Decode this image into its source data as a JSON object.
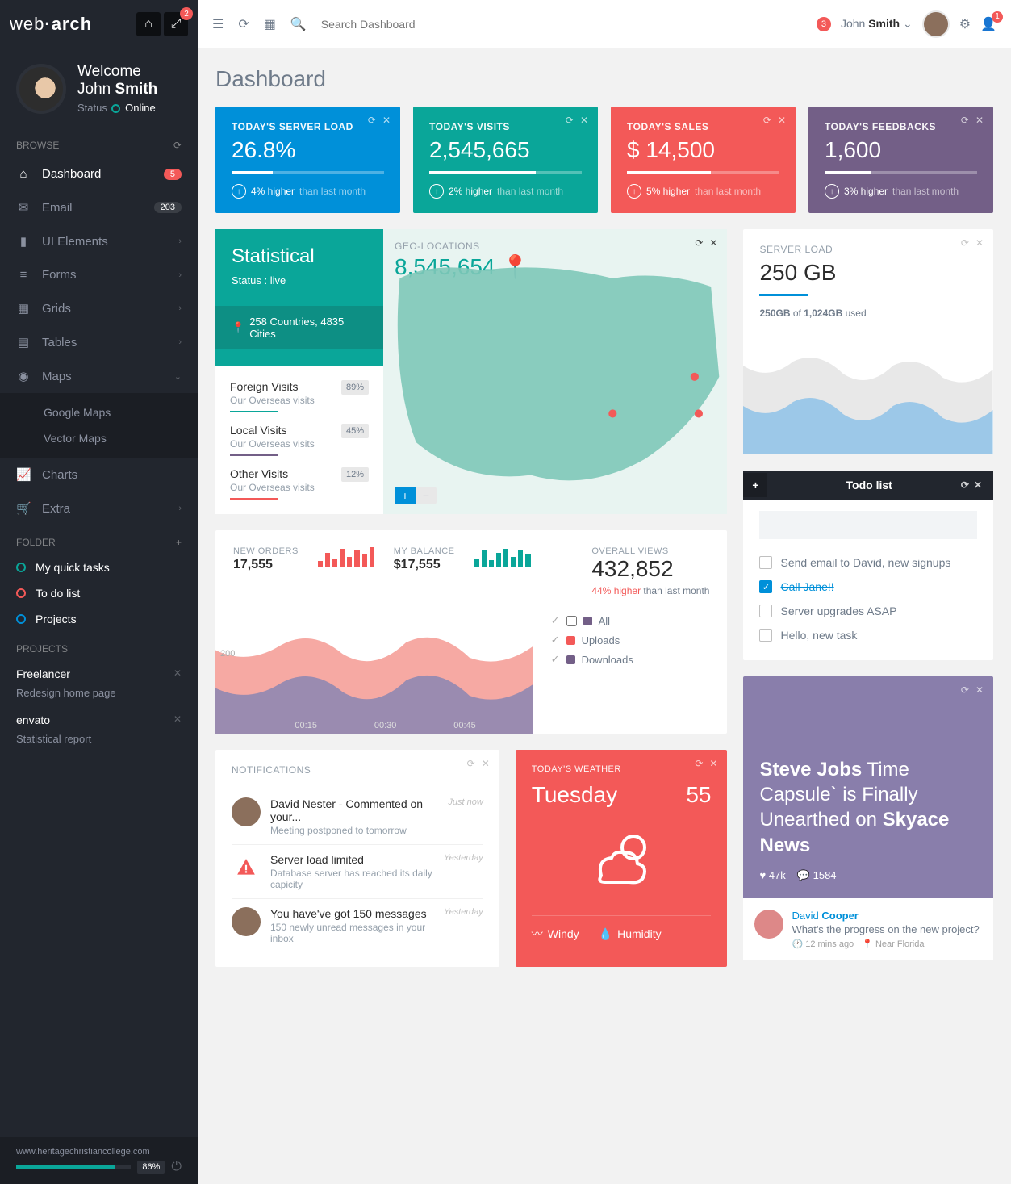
{
  "logo": {
    "part1": "web",
    "part2": "arch",
    "badge": "2"
  },
  "profile": {
    "welcome": "Welcome",
    "first": "John",
    "last": "Smith",
    "statusLabel": "Status",
    "statusVal": "Online"
  },
  "sections": {
    "browse": "BROWSE",
    "folder": "FOLDER",
    "projects": "PROJECTS"
  },
  "nav": {
    "dashboard": {
      "label": "Dashboard",
      "badge": "5"
    },
    "email": {
      "label": "Email",
      "badge": "203"
    },
    "ui": {
      "label": "UI Elements"
    },
    "forms": {
      "label": "Forms"
    },
    "grids": {
      "label": "Grids"
    },
    "tables": {
      "label": "Tables"
    },
    "maps": {
      "label": "Maps",
      "sub": {
        "google": "Google Maps",
        "vector": "Vector Maps"
      }
    },
    "charts": {
      "label": "Charts"
    },
    "extra": {
      "label": "Extra"
    }
  },
  "folders": {
    "quick": "My quick tasks",
    "todo": "To do list",
    "projects": "Projects"
  },
  "projectList": {
    "p1": {
      "name": "Freelancer",
      "sub": "Redesign home page"
    },
    "p2": {
      "name": "envato",
      "sub": "Statistical report"
    }
  },
  "footer": {
    "url": "www.heritagechristiancollege.com",
    "pct": "86%"
  },
  "topbar": {
    "searchPlaceholder": "Search Dashboard",
    "userBadge": "3",
    "userFirst": "John",
    "userLast": "Smith",
    "rightBadge": "1"
  },
  "pageTitle": "Dashboard",
  "stats": {
    "s1": {
      "title": "TODAY'S SERVER LOAD",
      "val": "26.8%",
      "barPct": 27,
      "diff": "4% higher",
      "sub": "than last month"
    },
    "s2": {
      "title": "TODAY'S VISITS",
      "val": "2,545,665",
      "barPct": 70,
      "diff": "2% higher",
      "sub": "than last month"
    },
    "s3": {
      "title": "TODAY'S SALES",
      "val": "$ 14,500",
      "barPct": 55,
      "diff": "5% higher",
      "sub": "than last month"
    },
    "s4": {
      "title": "TODAY'S FEEDBACKS",
      "val": "1,600",
      "barPct": 30,
      "diff": "3% higher",
      "sub": "than last month"
    }
  },
  "statistical": {
    "title": "Statistical",
    "status": "Status : live",
    "countries": "258 Countries, 4835 Cities"
  },
  "geo": {
    "title": "GEO-LOCATIONS",
    "val": "8,545,654"
  },
  "visits": {
    "v1": {
      "name": "Foreign Visits",
      "sub": "Our Overseas visits",
      "pct": "89%"
    },
    "v2": {
      "name": "Local Visits",
      "sub": "Our Overseas visits",
      "pct": "45%"
    },
    "v3": {
      "name": "Other Visits",
      "sub": "Our Overseas visits",
      "pct": "12%"
    }
  },
  "server": {
    "title": "SERVER LOAD",
    "val": "250 GB",
    "used": "250GB",
    "of": "of",
    "total": "1,024GB",
    "usedLabel": "used"
  },
  "orders": {
    "newLabel": "NEW ORDERS",
    "newVal": "17,555",
    "balLabel": "MY BALANCE",
    "balVal": "$17,555",
    "ovLabel": "OVERALL VIEWS",
    "ovVal": "432,852",
    "ovDiff": "44% higher",
    "ovSub": "than last month",
    "leg": {
      "all": "All",
      "up": "Uploads",
      "down": "Downloads"
    },
    "ticks": {
      "t1": "00:15",
      "t2": "00:30",
      "t3": "00:45"
    },
    "yval": "200"
  },
  "notif": {
    "title": "NOTIFICATIONS",
    "n1": {
      "title": "David Nester - Commented on your...",
      "sub": "Meeting postponed to tomorrow",
      "time": "Just now"
    },
    "n2": {
      "title": "Server load limited",
      "sub": "Database server has reached its daily capicity",
      "time": "Yesterday"
    },
    "n3": {
      "title": "You have've got 150 messages",
      "sub": "150 newly unread messages in your inbox",
      "time": "Yesterday"
    }
  },
  "weather": {
    "title": "TODAY'S WEATHER",
    "day": "Tuesday",
    "temp": "55",
    "windy": "Windy",
    "humid": "Humidity"
  },
  "todo": {
    "header": "Todo list",
    "t1": "Send email to David, new signups",
    "t2": "Call Jane!!",
    "t3": "Server upgrades ASAP",
    "t4": "Hello, new task"
  },
  "news": {
    "p1": "Steve Jobs",
    "p2": "Time Capsule` is Finally Unearthed on",
    "p3": "Skyace News",
    "likes": "47k",
    "comments": "1584",
    "commenter": {
      "first": "David",
      "last": "Cooper",
      "text": "What's the progress on the new project?",
      "time": "12 mins ago",
      "loc": "Near Florida"
    }
  }
}
